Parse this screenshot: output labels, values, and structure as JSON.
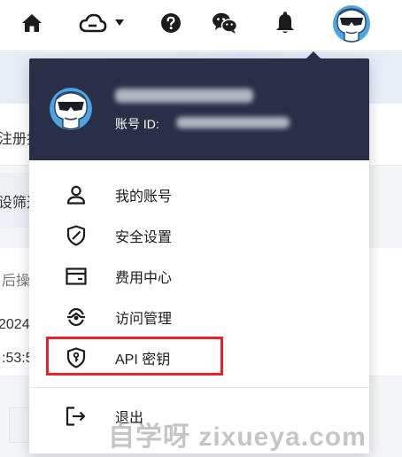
{
  "background": {
    "partial_texts": [
      "注册挂",
      "设筛选",
      "后操",
      "2024-0",
      ":53:5"
    ]
  },
  "account": {
    "id_label": "账号 ID:"
  },
  "menu": {
    "items": [
      {
        "label": "我的账号",
        "icon": "user-icon"
      },
      {
        "label": "安全设置",
        "icon": "shield-icon"
      },
      {
        "label": "费用中心",
        "icon": "billing-icon"
      },
      {
        "label": "访问管理",
        "icon": "access-icon"
      },
      {
        "label": "API 密钥",
        "icon": "key-shield-icon",
        "highlighted": true
      },
      {
        "label": "退出",
        "icon": "logout-icon"
      }
    ]
  },
  "watermark": "自学呀 zixueya.com",
  "colors": {
    "header_bg": "#2a2f48",
    "highlight": "#e8212e",
    "icon": "#1c1c1c"
  }
}
